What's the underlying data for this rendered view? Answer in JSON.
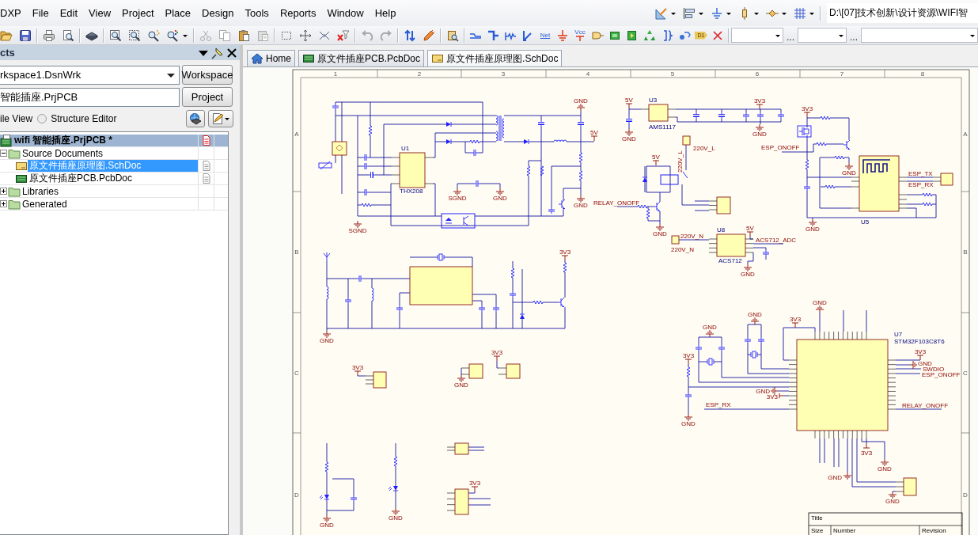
{
  "menu": [
    "DXP",
    "File",
    "Edit",
    "View",
    "Project",
    "Place",
    "Design",
    "Tools",
    "Reports",
    "Window",
    "Help"
  ],
  "path_field": {
    "value": "D:\\[07]技术创新\\设计资源\\WIFI智"
  },
  "wiring_toolbar": {
    "net_label": "Net",
    "power_port": "Vcc",
    "designator": "D1"
  },
  "filter_combos": {
    "separators": [
      "...",
      "..."
    ]
  },
  "panel": {
    "title": "cts",
    "workspace": {
      "value": "rkspace1.DsnWrk"
    },
    "workspace_button": "Workspace",
    "project": {
      "value": "智能插座.PrjPCB"
    },
    "project_button": "Project",
    "view_options": [
      {
        "label": "ile View"
      },
      {
        "label": "Structure Editor",
        "selected": false
      }
    ],
    "tree": [
      {
        "label": "wifi 智能插座.PrjPCB *",
        "kind": "project",
        "selected": false,
        "modified": true,
        "children": [
          {
            "label": "Source Documents",
            "kind": "folder",
            "selected": false,
            "expanded": true,
            "children": [
              {
                "label": "原文件插座原理图.SchDoc",
                "kind": "schdoc",
                "selected": true,
                "modified": false
              },
              {
                "label": "原文件插座PCB.PcbDoc",
                "kind": "pcbdoc",
                "selected": false,
                "modified": false
              }
            ]
          },
          {
            "label": "Libraries",
            "kind": "folder",
            "selected": false,
            "expanded": false
          },
          {
            "label": "Generated",
            "kind": "folder",
            "selected": false,
            "expanded": false
          }
        ]
      }
    ]
  },
  "document_tabs": [
    {
      "label": "Home",
      "kind": "home",
      "selected": false
    },
    {
      "label": "原文件插座PCB.PcbDoc",
      "kind": "pcbdoc",
      "selected": false
    },
    {
      "label": "原文件插座原理图.SchDoc",
      "kind": "schdoc",
      "selected": true
    }
  ],
  "schematic": {
    "zone_columns": [
      "1",
      "2",
      "3",
      "4",
      "5",
      "6",
      "7",
      "8"
    ],
    "zone_rows": [
      {
        "left": "A",
        "right": "A"
      },
      {
        "left": "B",
        "right": "B"
      },
      {
        "left": "C",
        "right": "C"
      },
      {
        "left": "D",
        "right": "D"
      }
    ],
    "symbols": [
      {
        "kind": "capacitor"
      },
      {
        "kind": "bridge"
      },
      {
        "kind": "varistor"
      },
      {
        "kind": "resistor"
      },
      {
        "kind": "capacitor"
      },
      {
        "kind": "capacitor"
      },
      {
        "kind": "electrolytic"
      },
      {
        "kind": "capacitor"
      },
      {
        "kind": "resistor"
      },
      {
        "kind": "ic"
      },
      {
        "kind": "diode"
      },
      {
        "kind": "diode"
      },
      {
        "kind": "resistor"
      },
      {
        "kind": "capacitor"
      },
      {
        "kind": "transformer"
      },
      {
        "kind": "diode"
      },
      {
        "kind": "electrolytic"
      },
      {
        "kind": "electrolytic"
      },
      {
        "kind": "inductor"
      },
      {
        "kind": "resistor"
      },
      {
        "kind": "resistor"
      },
      {
        "kind": "resistor"
      },
      {
        "kind": "resistor"
      },
      {
        "kind": "transistor"
      },
      {
        "kind": "capacitor"
      },
      {
        "kind": "opto"
      },
      {
        "kind": "capacitor"
      },
      {
        "kind": "ground"
      },
      {
        "kind": "power"
      },
      {
        "kind": "ground"
      },
      {
        "kind": "ground"
      },
      {
        "kind": "ground"
      },
      {
        "kind": "ground"
      },
      {
        "kind": "power"
      },
      {
        "kind": "ic"
      },
      {
        "kind": "electrolytic"
      },
      {
        "kind": "ground"
      },
      {
        "kind": "electrolytic"
      },
      {
        "kind": "electrolytic"
      },
      {
        "kind": "capacitor"
      },
      {
        "kind": "capacitor"
      },
      {
        "kind": "capacitor"
      },
      {
        "kind": "power"
      },
      {
        "kind": "ground"
      },
      {
        "kind": "connector"
      },
      {
        "kind": "relay"
      },
      {
        "kind": "diode"
      },
      {
        "kind": "power"
      },
      {
        "kind": "transistor"
      },
      {
        "kind": "resistor"
      },
      {
        "kind": "resistor"
      },
      {
        "kind": "ground"
      },
      {
        "kind": "connector"
      },
      {
        "kind": "ic"
      },
      {
        "kind": "power"
      },
      {
        "kind": "connector"
      },
      {
        "kind": "capacitor"
      },
      {
        "kind": "ground"
      },
      {
        "kind": "module"
      },
      {
        "kind": "connector"
      },
      {
        "kind": "mosfet"
      },
      {
        "kind": "power"
      },
      {
        "kind": "resistor"
      },
      {
        "kind": "transistor"
      },
      {
        "kind": "resistor"
      },
      {
        "kind": "resistor"
      },
      {
        "kind": "ground"
      },
      {
        "kind": "resistor"
      },
      {
        "kind": "capacitor"
      },
      {
        "kind": "resistor"
      },
      {
        "kind": "resistor"
      },
      {
        "kind": "resistor"
      },
      {
        "kind": "ground"
      },
      {
        "kind": "antenna"
      },
      {
        "kind": "ic"
      },
      {
        "kind": "crystal"
      },
      {
        "kind": "inductor"
      },
      {
        "kind": "inductor"
      },
      {
        "kind": "capacitor"
      },
      {
        "kind": "capacitor"
      },
      {
        "kind": "capacitor"
      },
      {
        "kind": "capacitor"
      },
      {
        "kind": "capacitor"
      },
      {
        "kind": "resistor"
      },
      {
        "kind": "capacitor"
      },
      {
        "kind": "resistor"
      },
      {
        "kind": "transistor"
      },
      {
        "kind": "diode"
      },
      {
        "kind": "resistor"
      },
      {
        "kind": "power"
      },
      {
        "kind": "ground"
      },
      {
        "kind": "connector"
      },
      {
        "kind": "power"
      },
      {
        "kind": "connector"
      },
      {
        "kind": "ground"
      },
      {
        "kind": "connector"
      },
      {
        "kind": "power"
      },
      {
        "kind": "resistor"
      },
      {
        "kind": "led"
      },
      {
        "kind": "capacitor"
      },
      {
        "kind": "ground"
      },
      {
        "kind": "resistor"
      },
      {
        "kind": "led"
      },
      {
        "kind": "ground"
      },
      {
        "kind": "connector"
      },
      {
        "kind": "connector"
      },
      {
        "kind": "power"
      },
      {
        "kind": "ic"
      },
      {
        "kind": "crystal"
      },
      {
        "kind": "crystal"
      },
      {
        "kind": "capacitor"
      },
      {
        "kind": "capacitor"
      },
      {
        "kind": "capacitor"
      },
      {
        "kind": "capacitor"
      },
      {
        "kind": "ground"
      },
      {
        "kind": "ground"
      },
      {
        "kind": "power"
      },
      {
        "kind": "resistor"
      },
      {
        "kind": "capacitor"
      },
      {
        "kind": "ground"
      },
      {
        "kind": "ground"
      },
      {
        "kind": "power"
      },
      {
        "kind": "power"
      },
      {
        "kind": "ground"
      },
      {
        "kind": "power"
      },
      {
        "kind": "ground"
      },
      {
        "kind": "power"
      },
      {
        "kind": "ground"
      },
      {
        "kind": "ground"
      },
      {
        "kind": "connector"
      },
      {
        "kind": "ground"
      }
    ],
    "labels": [
      {
        "kind": "ground",
        "text": "GND"
      },
      {
        "kind": "power",
        "text": "5V"
      },
      {
        "kind": "part",
        "text": "U3"
      },
      {
        "kind": "power",
        "text": "3V3"
      },
      {
        "kind": "power",
        "text": "3V3"
      },
      {
        "kind": "part",
        "text": "AMS1117"
      },
      {
        "kind": "power",
        "text": "5V"
      },
      {
        "kind": "ground",
        "text": "GND"
      },
      {
        "kind": "ground",
        "text": "GND"
      },
      {
        "kind": "part",
        "text": "U1"
      },
      {
        "kind": "net",
        "text": "220V_L"
      },
      {
        "kind": "net",
        "text": "ESP_ONOFF"
      },
      {
        "kind": "power",
        "text": "5V"
      },
      {
        "kind": "net",
        "text": "220V_L"
      },
      {
        "kind": "ground",
        "text": "GND"
      },
      {
        "kind": "net",
        "text": "ESP_TX"
      },
      {
        "kind": "net",
        "text": "ESP_RX"
      },
      {
        "kind": "part",
        "text": "THX208"
      },
      {
        "kind": "ground",
        "text": "SGND"
      },
      {
        "kind": "ground",
        "text": "GND"
      },
      {
        "kind": "ground",
        "text": "GND"
      },
      {
        "kind": "net",
        "text": "RELAY_ONOFF"
      },
      {
        "kind": "part",
        "text": "U5"
      },
      {
        "kind": "ground",
        "text": "SGND"
      },
      {
        "kind": "ground",
        "text": "GND"
      },
      {
        "kind": "part",
        "text": "U8"
      },
      {
        "kind": "power",
        "text": "5V"
      },
      {
        "kind": "ground",
        "text": "GND"
      },
      {
        "kind": "net",
        "text": "220V_N"
      },
      {
        "kind": "net",
        "text": "ACS712_ADC"
      },
      {
        "kind": "power",
        "text": "3V3"
      },
      {
        "kind": "net",
        "text": "220V_N"
      },
      {
        "kind": "part",
        "text": "ACS712"
      },
      {
        "kind": "ground",
        "text": "GND"
      },
      {
        "kind": "ground",
        "text": "GND"
      },
      {
        "kind": "ground",
        "text": "GND"
      },
      {
        "kind": "power",
        "text": "3V3"
      },
      {
        "kind": "ground",
        "text": "GND"
      },
      {
        "kind": "part",
        "text": "U7"
      },
      {
        "kind": "ground",
        "text": "GND"
      },
      {
        "kind": "part",
        "text": "STM32F103C8T6"
      },
      {
        "kind": "power",
        "text": "3V3"
      },
      {
        "kind": "power",
        "text": "3V3"
      },
      {
        "kind": "power",
        "text": "3V3"
      },
      {
        "kind": "power",
        "text": "3V3"
      },
      {
        "kind": "ground",
        "text": "GND"
      },
      {
        "kind": "net",
        "text": "SWDIO"
      },
      {
        "kind": "net",
        "text": "ESP_ONOFF"
      },
      {
        "kind": "ground",
        "text": "GND"
      },
      {
        "kind": "ground",
        "text": "GND"
      },
      {
        "kind": "power",
        "text": "3V3"
      },
      {
        "kind": "net",
        "text": "ESP_RX"
      },
      {
        "kind": "net",
        "text": "RELAY_ONOFF"
      },
      {
        "kind": "ground",
        "text": "GND"
      },
      {
        "kind": "power",
        "text": "3V3"
      },
      {
        "kind": "ground",
        "text": "GND"
      },
      {
        "kind": "ground",
        "text": "GND"
      },
      {
        "kind": "power",
        "text": "3V3"
      },
      {
        "kind": "ground",
        "text": "GND"
      },
      {
        "kind": "ground",
        "text": "GND"
      },
      {
        "kind": "ground",
        "text": "GND"
      }
    ],
    "title_block": [
      "Title",
      "Size",
      "Number",
      "Revision"
    ]
  }
}
